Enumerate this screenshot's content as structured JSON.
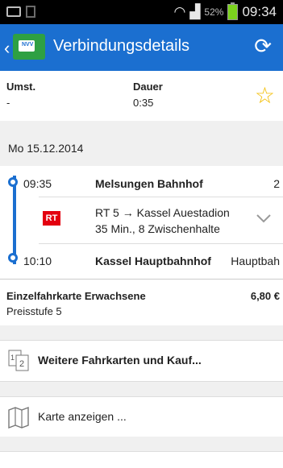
{
  "status_bar": {
    "battery": "52%",
    "time": "09:34"
  },
  "app_bar": {
    "title": "Verbindungsdetails",
    "logo_text": "NVV"
  },
  "summary": {
    "umst_label": "Umst.",
    "umst_value": "-",
    "dauer_label": "Dauer",
    "dauer_value": "0:35"
  },
  "date": "Mo 15.12.2014",
  "journey": {
    "departure": {
      "time": "09:35",
      "station": "Melsungen Bahnhof",
      "platform": "2"
    },
    "transport": {
      "badge": "RT",
      "line": "RT 5 → Kassel Auestadion",
      "details": "35 Min., 8 Zwischenhalte"
    },
    "arrival": {
      "time": "10:10",
      "station": "Kassel Hauptbahnhof",
      "platform": "Hauptbah"
    }
  },
  "fare": {
    "name": "Einzelfahrkarte Erwachsene",
    "level": "Preisstufe 5",
    "price": "6,80 €"
  },
  "actions": {
    "tickets": "Weitere Fahrkarten und Kauf...",
    "map": "Karte anzeigen ..."
  },
  "colors": {
    "app_bar": "#1b6fd0",
    "rt_badge": "#e3000f",
    "star": "#f3bd00"
  }
}
